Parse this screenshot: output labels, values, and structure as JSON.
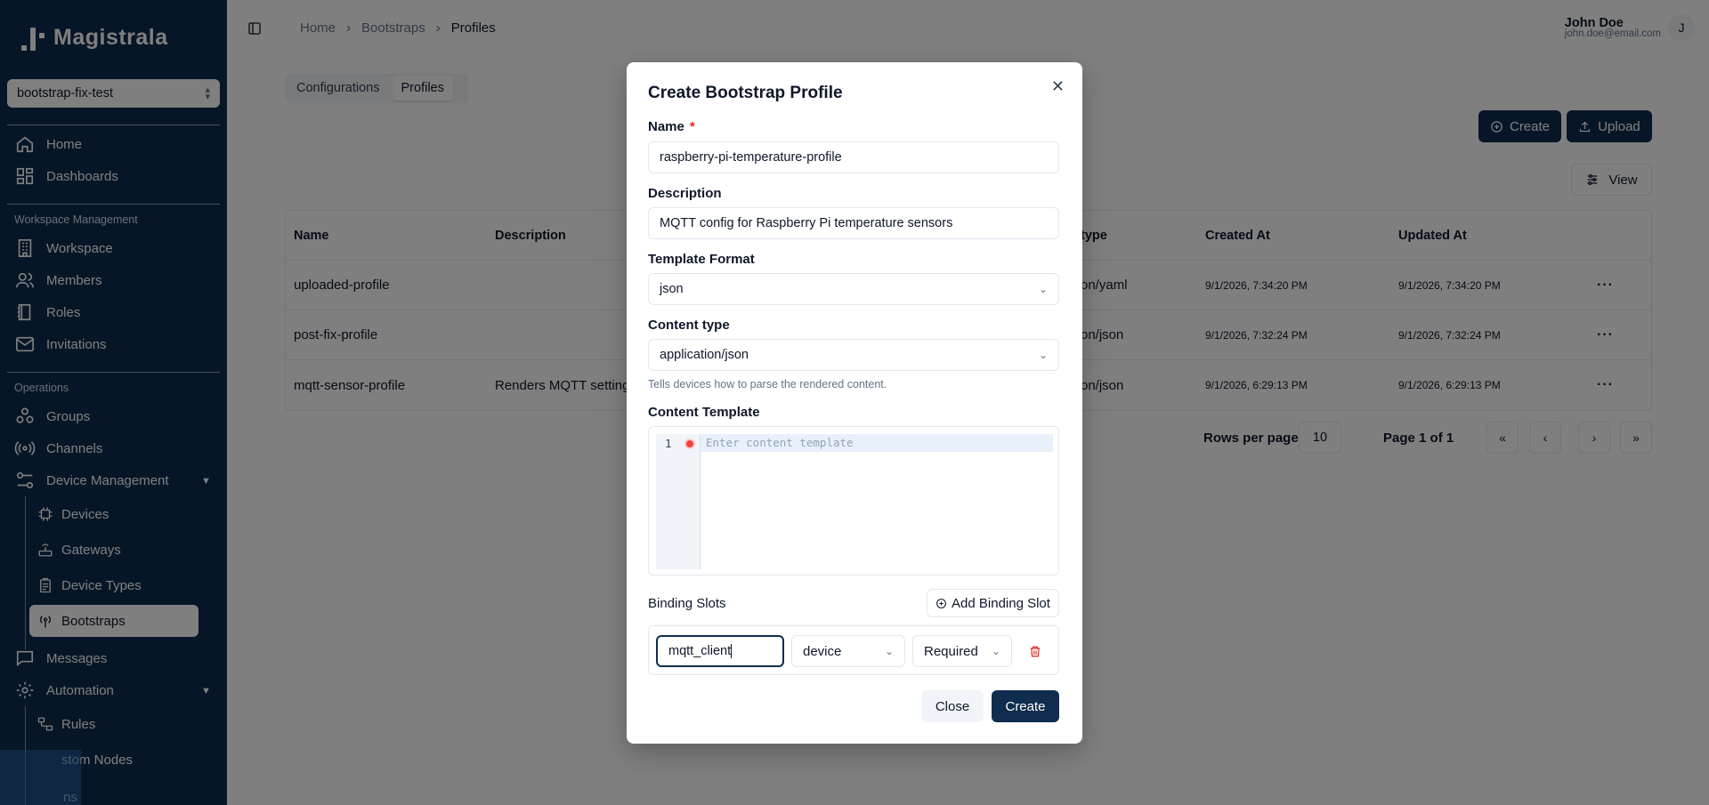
{
  "app": {
    "name": "Magistrala"
  },
  "workspace_selector": {
    "value": "bootstrap-fix-test"
  },
  "sidebar": {
    "top_items": [
      {
        "label": "Home",
        "icon": "home-icon"
      },
      {
        "label": "Dashboards",
        "icon": "dashboard-icon"
      }
    ],
    "workspace_section": "Workspace Management",
    "workspace_items": [
      {
        "label": "Workspace",
        "icon": "building-icon"
      },
      {
        "label": "Members",
        "icon": "users-icon"
      },
      {
        "label": "Roles",
        "icon": "book-icon"
      },
      {
        "label": "Invitations",
        "icon": "mail-icon"
      }
    ],
    "operations_section": "Operations",
    "operations_items": [
      {
        "label": "Groups",
        "icon": "groups-icon"
      },
      {
        "label": "Channels",
        "icon": "broadcast-icon"
      },
      {
        "label": "Device Management",
        "icon": "sliders-icon"
      }
    ],
    "device_items": [
      {
        "label": "Devices",
        "icon": "cpu-icon"
      },
      {
        "label": "Gateways",
        "icon": "router-icon"
      },
      {
        "label": "Device Types",
        "icon": "clipboard-icon"
      },
      {
        "label": "Bootstraps",
        "icon": "antenna-icon"
      }
    ],
    "after_items": [
      {
        "label": "Messages",
        "icon": "message-icon"
      },
      {
        "label": "Automation",
        "icon": "gear-icon"
      }
    ],
    "automation_items": [
      {
        "label": "Rules",
        "icon": "workflow-icon"
      },
      {
        "label": "stom Nodes"
      },
      {
        "label": "ns"
      }
    ]
  },
  "breadcrumb": [
    "Home",
    "Bootstraps",
    "Profiles"
  ],
  "user": {
    "name": "John Doe",
    "email": "john.doe@email.com",
    "initial": "J"
  },
  "tabs": [
    "Configurations",
    "Profiles"
  ],
  "toolbar": {
    "create_label": "Create",
    "upload_label": "Upload",
    "view_label": "View"
  },
  "table": {
    "columns": [
      "Name",
      "Description",
      "type",
      "Created At",
      "Updated At"
    ],
    "rows": [
      {
        "name": "uploaded-profile",
        "description": "",
        "type": "on/yaml",
        "created": "9/1/2026, 7:34:20 PM",
        "updated": "9/1/2026, 7:34:20 PM"
      },
      {
        "name": "post-fix-profile",
        "description": "",
        "type": "on/json",
        "created": "9/1/2026, 7:32:24 PM",
        "updated": "9/1/2026, 7:32:24 PM"
      },
      {
        "name": "mqtt-sensor-profile",
        "description": "Renders MQTT setting",
        "type": "on/json",
        "created": "9/1/2026, 6:29:13 PM",
        "updated": "9/1/2026, 6:29:13 PM"
      }
    ]
  },
  "pagination": {
    "rows_per_page_label": "Rows per page",
    "rows_per_page": "10",
    "page_text": "Page 1 of 1"
  },
  "modal": {
    "title": "Create Bootstrap Profile",
    "name_label": "Name",
    "name_required": "*",
    "name_value": "raspberry-pi-temperature-profile",
    "description_label": "Description",
    "description_value": "MQTT config for Raspberry Pi temperature sensors",
    "template_format_label": "Template Format",
    "template_format_value": "json",
    "content_type_label": "Content type",
    "content_type_value": "application/json",
    "content_type_hint": "Tells devices how to parse the rendered content.",
    "content_template_label": "Content Template",
    "editor_line_number": "1",
    "editor_placeholder": "Enter content template",
    "binding_slots_label": "Binding Slots",
    "add_binding_slot_label": "Add Binding Slot",
    "binding": {
      "name": "mqtt_client",
      "type": "device",
      "requirement": "Required"
    },
    "close_label": "Close",
    "create_label": "Create"
  }
}
